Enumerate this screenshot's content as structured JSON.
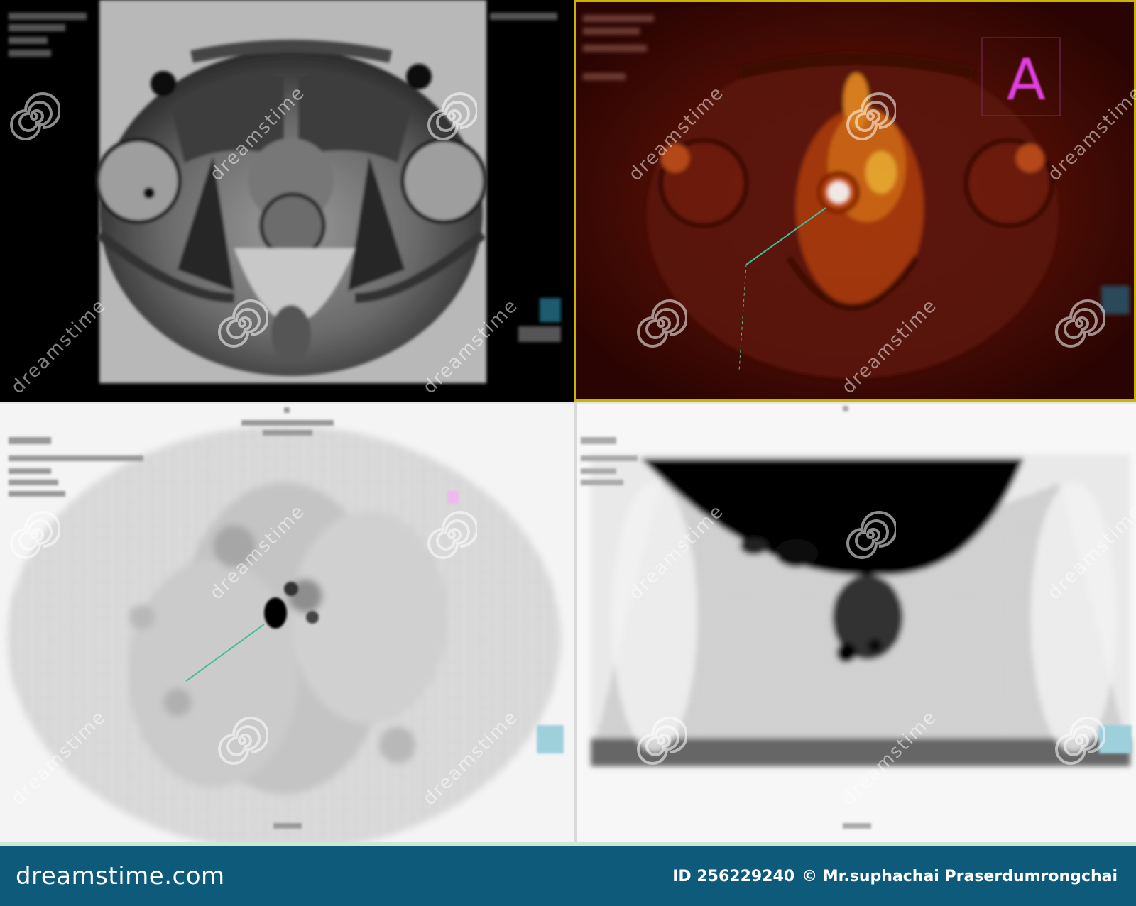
{
  "overlay": {
    "pane_letter": "A",
    "watermark_text": "dreamstime"
  },
  "footer": {
    "brand": "dreamstime.com",
    "id_label": "ID 256229240",
    "author": "© Mr.suphachai Praserdumrongchai"
  },
  "colors": {
    "footer_bg": "#0d5a7a",
    "footer_stripe": "#cfe7d9",
    "active_frame": "#c8b400",
    "marker": "#e040e0",
    "arrow": "#3fbf9a"
  },
  "panes": [
    {
      "name": "t2-axial-mri",
      "tone": "grayscale"
    },
    {
      "name": "pet-mri-fusion",
      "tone": "hot"
    },
    {
      "name": "pet-axial-inverted",
      "tone": "inverted-gray"
    },
    {
      "name": "pet-mip-inverted",
      "tone": "inverted-gray"
    }
  ]
}
